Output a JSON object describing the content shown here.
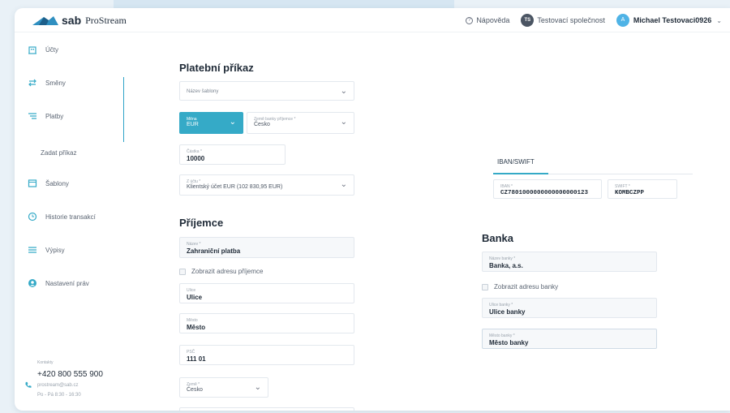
{
  "header": {
    "logo_sab": "sab",
    "logo_pro": "ProStream",
    "help": "Nápověda",
    "company_initials": "TS",
    "company": "Testovací společnost",
    "user_initial": "A",
    "user_name": "Michael Testovaci0926"
  },
  "sidebar": {
    "items": [
      {
        "label": "Účty",
        "icon": "building-icon"
      },
      {
        "label": "Směny",
        "icon": "exchange-icon"
      },
      {
        "label": "Platby",
        "icon": "payments-icon"
      },
      {
        "label": "Šablony",
        "icon": "template-icon"
      },
      {
        "label": "Historie transakcí",
        "icon": "history-icon"
      },
      {
        "label": "Výpisy",
        "icon": "list-icon"
      },
      {
        "label": "Nastavení práv",
        "icon": "rights-icon"
      }
    ],
    "sub_item": "Zadat příkaz",
    "contact": {
      "label": "Kontakty",
      "phone": "+420 800 555 900",
      "email": "prostream@sab.cz",
      "hours": "Po - Pá 8:30 - 16:30"
    }
  },
  "payment": {
    "title": "Platební příkaz",
    "template_placeholder": "Název šablony",
    "currency": {
      "label": "Měna",
      "value": "EUR"
    },
    "bank_country": {
      "label": "Země banky příjemce *",
      "value": "Česko"
    },
    "amount": {
      "label": "Částka *",
      "value": "10000"
    },
    "from_account": {
      "label": "Z účtu *",
      "value": "Klientský účet EUR (102 830,95 EUR)"
    }
  },
  "recipient": {
    "title": "Příjemce",
    "name": {
      "label": "Název *",
      "value": "Zahraniční platba"
    },
    "show_address": "Zobrazit adresu příjemce",
    "street": {
      "label": "Ulice",
      "value": "Ulice"
    },
    "city": {
      "label": "Město",
      "value": "Město"
    },
    "zip": {
      "label": "PSČ",
      "value": "111 01"
    },
    "country": {
      "label": "Země *",
      "value": "Česko"
    }
  },
  "iban_tab": "IBAN/SWIFT",
  "iban": {
    "label": "IBAN *",
    "value": "CZ7801000000000000000123"
  },
  "swift": {
    "label": "SWIFT *",
    "value": "KOMBCZPP"
  },
  "bank": {
    "title": "Banka",
    "name": {
      "label": "Název banky *",
      "value": "Banka, a.s."
    },
    "show_address": "Zobrazit adresu banky",
    "street": {
      "label": "Ulice banky *",
      "value": "Ulice banky"
    },
    "city": {
      "label": "Město banky *",
      "value": "Město banky"
    }
  },
  "colors": {
    "accent": "#35aac7",
    "text": "#1f2a37"
  }
}
